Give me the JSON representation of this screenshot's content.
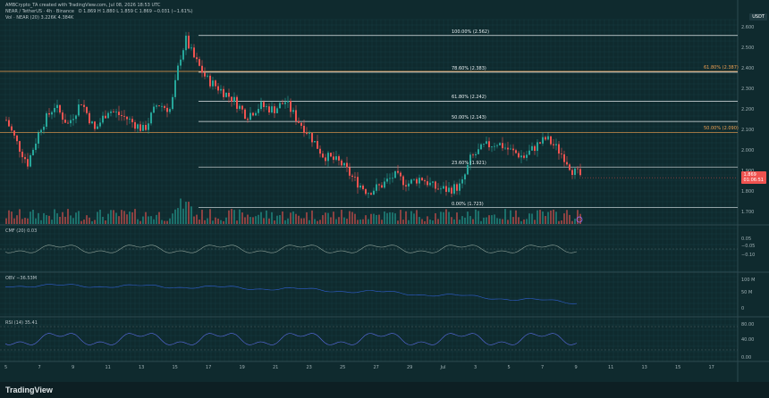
{
  "header": {
    "publisher": "AMBCrypto_TA created with TradingView.com, Jul 08, 2026 18:53 UTC",
    "symbol": "NEAR / TetherUS · 4h · Binance",
    "ohlc": "O 1.869  H 1.880  L 1.859  C 1.869  −0.031 (−1.61%)",
    "volume": "Vol · NEAR (20)  3.226K  4.384K",
    "quote_currency": "USDT"
  },
  "price_axis": {
    "labels": [
      "2.600",
      "2.500",
      "2.400",
      "2.300",
      "2.200",
      "2.100",
      "2.000",
      "1.900",
      "1.800",
      "1.700"
    ],
    "current_price": "1.869",
    "current_countdown": "01:06:51"
  },
  "fib_levels": [
    {
      "label": "100.00% (2.562)",
      "price": 2.562
    },
    {
      "label": "78.60% (2.383)",
      "price": 2.383
    },
    {
      "label": "61.80% (2.242)",
      "price": 2.242
    },
    {
      "label": "50.00% (2.143)",
      "price": 2.143
    },
    {
      "label": "23.60% (1.921)",
      "price": 1.921
    },
    {
      "label": "0.00% (1.723)",
      "price": 1.723
    }
  ],
  "fib_orange": [
    {
      "label": "61.80% (2.387)",
      "price": 2.387
    },
    {
      "label": "50.00% (2.090)",
      "price": 2.09
    }
  ],
  "panes": {
    "cmf": {
      "title": "CMF (20)  0.03",
      "axis": [
        "0.05",
        "−0.05",
        "−0.10"
      ]
    },
    "obv": {
      "title": "OBV  −36.53M",
      "axis": [
        "100 M",
        "50 M",
        "0"
      ]
    },
    "rsi": {
      "title": "RSI (14)  35.41",
      "axis": [
        "80.00",
        "40.00",
        "0.00"
      ]
    }
  },
  "date_axis": [
    "5",
    "7",
    "9",
    "11",
    "13",
    "15",
    "17",
    "19",
    "21",
    "23",
    "25",
    "27",
    "29",
    "Jul",
    "3",
    "5",
    "7",
    "9",
    "11",
    "13",
    "15",
    "17"
  ],
  "footer": {
    "brand": "TradingView"
  },
  "colors": {
    "bull": "#26a69a",
    "bear": "#ef5350",
    "bg": "#0f2a2e",
    "fib_white": "#e0e6e8",
    "fib_orange": "#f0a050",
    "cmf_line": "#8fa39a",
    "obv_line": "#2f5fd0",
    "rsi_line": "#5b6ee8"
  }
}
